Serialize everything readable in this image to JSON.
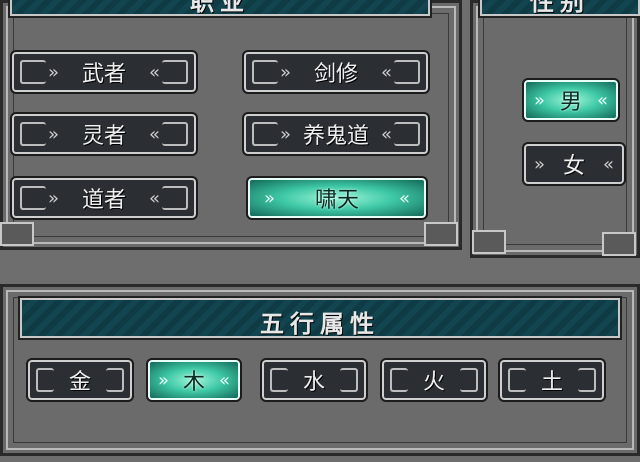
{
  "panels": {
    "profession": {
      "title": "职业",
      "buttons": [
        {
          "label": "武者",
          "selected": false
        },
        {
          "label": "剑修",
          "selected": false
        },
        {
          "label": "灵者",
          "selected": false
        },
        {
          "label": "养鬼道",
          "selected": false
        },
        {
          "label": "道者",
          "selected": false
        },
        {
          "label": "啸天",
          "selected": true
        }
      ]
    },
    "gender": {
      "title": "性别",
      "buttons": [
        {
          "label": "男",
          "selected": true
        },
        {
          "label": "女",
          "selected": false
        }
      ]
    },
    "element": {
      "title": "五行属性",
      "buttons": [
        {
          "label": "金",
          "selected": false
        },
        {
          "label": "木",
          "selected": true
        },
        {
          "label": "水",
          "selected": false
        },
        {
          "label": "火",
          "selected": false
        },
        {
          "label": "土",
          "selected": false
        }
      ]
    }
  },
  "colors": {
    "selected_glow": "#3fc9a6",
    "header_teal": "#0f3b44",
    "panel_gray": "#6b6b6b"
  }
}
